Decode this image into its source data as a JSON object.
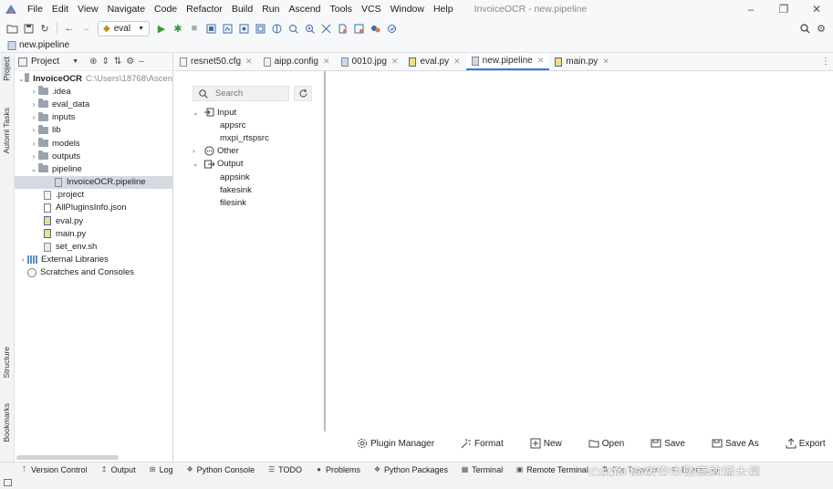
{
  "menubar": {
    "items": [
      "File",
      "Edit",
      "View",
      "Navigate",
      "Code",
      "Refactor",
      "Build",
      "Run",
      "Ascend",
      "Tools",
      "VCS",
      "Window",
      "Help"
    ],
    "title": "InvoiceOCR - new.pipeline"
  },
  "toolbar": {
    "run_config": "eval"
  },
  "breadcrumb": {
    "file": "new.pipeline"
  },
  "leftstrip": {
    "project": "Project",
    "tasks": "Automl Tasks",
    "structure": "Structure",
    "bookmarks": "Bookmarks"
  },
  "project": {
    "header_label": "Project",
    "root": {
      "name": "InvoiceOCR",
      "path": "C:\\Users\\18768\\Ascen"
    },
    "folders": [
      ".idea",
      "eval_data",
      "inputs",
      "lib",
      "models",
      "outputs",
      "pipeline"
    ],
    "pipeline_file": "InvoiceOCR.pipeline",
    "files": [
      ".project",
      "AllPluginsInfo.json",
      "eval.py",
      "main.py",
      "set_env.sh"
    ],
    "external": "External Libraries",
    "scratches": "Scratches and Consoles"
  },
  "tabs": [
    {
      "label": "resnet50.cfg",
      "kind": "cfg"
    },
    {
      "label": "aipp.config",
      "kind": "cfg"
    },
    {
      "label": "0010.jpg",
      "kind": "jpg"
    },
    {
      "label": "eval.py",
      "kind": "py"
    },
    {
      "label": "new.pipeline",
      "kind": "pl",
      "active": true
    },
    {
      "label": "main.py",
      "kind": "py"
    }
  ],
  "palette": {
    "search_placeholder": "Search",
    "groups": [
      {
        "name": "Input",
        "expanded": true,
        "children": [
          "appsrc",
          "mxpi_rtspsrc"
        ]
      },
      {
        "name": "Other",
        "expanded": false,
        "children": []
      },
      {
        "name": "Output",
        "expanded": true,
        "children": [
          "appsink",
          "fakesink",
          "filesink"
        ]
      }
    ]
  },
  "actions": {
    "plugin_manager": "Plugin Manager",
    "format": "Format",
    "new": "New",
    "open": "Open",
    "save": "Save",
    "save_as": "Save As",
    "export": "Export"
  },
  "toolwindows": {
    "version_control": "Version Control",
    "output": "Output",
    "log": "Log",
    "python_console": "Python Console",
    "todo": "TODO",
    "problems": "Problems",
    "python_packages": "Python Packages",
    "terminal": "Terminal",
    "remote_terminal": "Remote Terminal",
    "file_transfer": "File Transfer",
    "event_log": "Event Log"
  },
  "watermark": "CSDN @夜空中坠亮的派大星"
}
